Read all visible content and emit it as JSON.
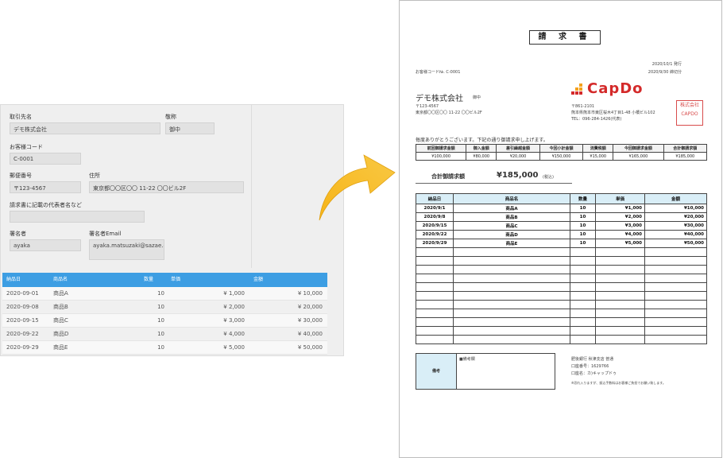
{
  "form": {
    "client_label": "取引先名",
    "client_value": "デモ株式会社",
    "honorific_label": "敬称",
    "honorific_value": "御中",
    "customer_code_label": "お客様コード",
    "customer_code_value": "C-0001",
    "zip_label": "郵便番号",
    "zip_value": "〒123-4567",
    "address_label": "住所",
    "address_value": "東京都〇〇区〇〇 11-22 〇〇ビル2F",
    "rep_label": "請求書に記載の代表者名など",
    "rep_value": "",
    "signer_label": "署名者",
    "signer_value": "ayaka",
    "signer_email_label": "署名者Email",
    "signer_email_value": "ayaka.matsuzaki@sazae.com.au"
  },
  "grid": {
    "headers": [
      "納品日",
      "商品名",
      "数量",
      "単価",
      "金額"
    ],
    "rows": [
      [
        "2020-09-01",
        "商品A",
        "10",
        "¥ 1,000",
        "¥ 10,000"
      ],
      [
        "2020-09-08",
        "商品B",
        "10",
        "¥ 2,000",
        "¥ 20,000"
      ],
      [
        "2020-09-15",
        "商品C",
        "10",
        "¥ 3,000",
        "¥ 30,000"
      ],
      [
        "2020-09-22",
        "商品D",
        "10",
        "¥ 4,000",
        "¥ 40,000"
      ],
      [
        "2020-09-29",
        "商品E",
        "10",
        "¥ 5,000",
        "¥ 50,000"
      ]
    ],
    "header_color": "#3d9ee3"
  },
  "invoice": {
    "title": "請 求 書",
    "customer_code": "お客様コード№. C-0001",
    "issue_date": "2020/10/1 発行",
    "cutoff_date": "2020/9/30 締切分",
    "client": "デモ株式会社",
    "honorific": "御中",
    "client_zip": "〒123-4567",
    "client_address": "東京都〇〇区〇〇 11-22 〇〇ビル2F",
    "logo_text": "CapDo",
    "sender_zip": "〒861-2101",
    "sender_address": "熊本県熊本市東区桜木4丁目1-48 小橋ビル102",
    "sender_tel": "TEL：096-284-1426(代表)",
    "stamp_text": "株式会社 CAPDO",
    "greeting": "毎度ありがとうございます。下記の通り御請求申し上げます。",
    "summary_headers": [
      "前回御請求金額",
      "御入金額",
      "差引繰越金額",
      "今回小計金額",
      "消費税額",
      "今回御請求金額",
      "合計御請求額"
    ],
    "summary_values": [
      "¥100,000",
      "¥80,000",
      "¥20,000",
      "¥150,000",
      "¥15,000",
      "¥165,000",
      "¥185,000"
    ],
    "total_label": "合計御請求額",
    "total_value": "¥185,000",
    "tax_note": "(税込)",
    "items_headers": [
      "納品日",
      "商品名",
      "数量",
      "単価",
      "金額"
    ],
    "items": [
      [
        "2020/9/1",
        "商品A",
        "10",
        "¥1,000",
        "¥10,000"
      ],
      [
        "2020/9/8",
        "商品B",
        "10",
        "¥2,000",
        "¥20,000"
      ],
      [
        "2020/9/15",
        "商品C",
        "10",
        "¥3,000",
        "¥30,000"
      ],
      [
        "2020/9/22",
        "商品D",
        "10",
        "¥4,000",
        "¥40,000"
      ],
      [
        "2020/9/29",
        "商品E",
        "10",
        "¥5,000",
        "¥50,000"
      ]
    ],
    "blank_rows": 11,
    "remark_label": "備考",
    "remark_field": "■備考欄",
    "bank_line1": "肥後銀行 秋津支店 普通",
    "bank_line2": "口座番号：1629766",
    "bank_line3": "口座名：カ)キャップドゥ",
    "bank_note": "※恐れ入りますが、振込手数料はお客様ご負担でお願い致します。",
    "accent_color": "#d42a2a",
    "header_fill": "#d9eef7"
  },
  "arrow_color": "#f6b418"
}
